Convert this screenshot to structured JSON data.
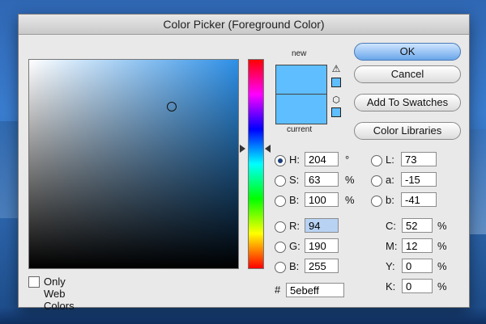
{
  "window": {
    "title": "Color Picker (Foreground Color)"
  },
  "preview": {
    "new_label": "new",
    "current_label": "current",
    "new_color": "#5ebeff",
    "current_color": "#5ebeff",
    "warning_icon": "warning-triangle-icon",
    "websafe_icon": "cube-icon"
  },
  "buttons": {
    "ok": "OK",
    "cancel": "Cancel",
    "add_to_swatches": "Add To Swatches",
    "color_libraries": "Color Libraries"
  },
  "hsb": {
    "h": {
      "label": "H:",
      "value": "204",
      "unit": "°",
      "selected": true
    },
    "s": {
      "label": "S:",
      "value": "63",
      "unit": "%",
      "selected": false
    },
    "b": {
      "label": "B:",
      "value": "100",
      "unit": "%",
      "selected": false
    }
  },
  "rgb": {
    "r": {
      "label": "R:",
      "value": "94"
    },
    "g": {
      "label": "G:",
      "value": "190"
    },
    "b": {
      "label": "B:",
      "value": "255"
    }
  },
  "lab": {
    "l": {
      "label": "L:",
      "value": "73"
    },
    "a": {
      "label": "a:",
      "value": "-15"
    },
    "b": {
      "label": "b:",
      "value": "-41"
    }
  },
  "cmyk": {
    "c": {
      "label": "C:",
      "value": "52",
      "unit": "%"
    },
    "m": {
      "label": "M:",
      "value": "12",
      "unit": "%"
    },
    "y": {
      "label": "Y:",
      "value": "0",
      "unit": "%"
    },
    "k": {
      "label": "K:",
      "value": "0",
      "unit": "%"
    }
  },
  "hex": {
    "prefix": "#",
    "value": "5ebeff"
  },
  "only_web_colors": {
    "label": "Only Web Colors",
    "checked": false
  },
  "colors": {
    "field_hue": "#2d8fe6",
    "ok_button": "#6aa6ea"
  }
}
